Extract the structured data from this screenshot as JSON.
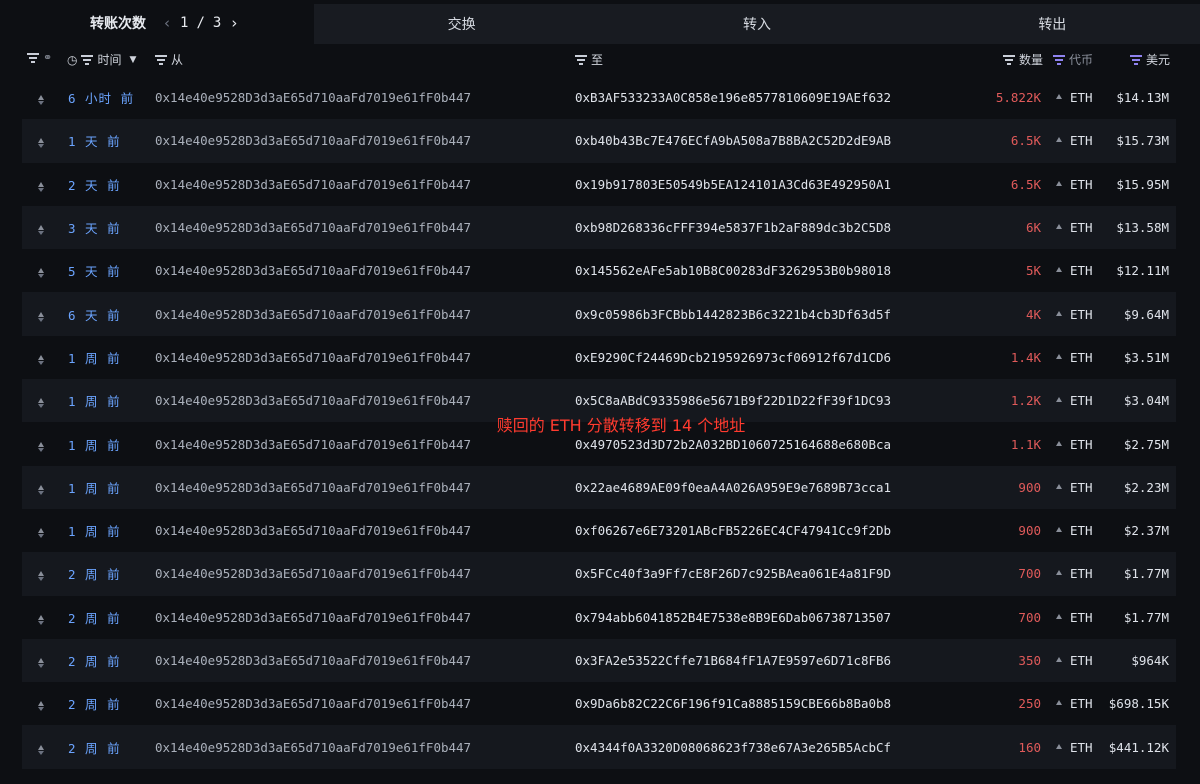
{
  "tabs": {
    "transfers_label": "转账次数",
    "page_current": "1",
    "page_sep": "/",
    "page_total": "3",
    "swap": "交换",
    "inflow": "转入",
    "outflow": "转出"
  },
  "columns": {
    "time": "时间",
    "from": "从",
    "to": "至",
    "amount": "数量",
    "token": "代币",
    "usd": "美元"
  },
  "accent_colors": {
    "time_link": "#6ba4ff",
    "amount_out": "#e05a5a",
    "filter_purple": "#8f83f0",
    "overlay_text": "#ff3b2f"
  },
  "rows": [
    {
      "time": "6 小时 前",
      "from": "0x14e40e9528D3d3aE65d710aaFd7019e61fF0b447",
      "to": "0xB3AF533233A0C858e196e8577810609E19AEf632",
      "amount": "5.822K",
      "token": "ETH",
      "usd": "$14.13M"
    },
    {
      "time": "1 天 前",
      "from": "0x14e40e9528D3d3aE65d710aaFd7019e61fF0b447",
      "to": "0xb40b43Bc7E476ECfA9bA508a7B8BA2C52D2dE9AB",
      "amount": "6.5K",
      "token": "ETH",
      "usd": "$15.73M"
    },
    {
      "time": "2 天 前",
      "from": "0x14e40e9528D3d3aE65d710aaFd7019e61fF0b447",
      "to": "0x19b917803E50549b5EA124101A3Cd63E492950A1",
      "amount": "6.5K",
      "token": "ETH",
      "usd": "$15.95M"
    },
    {
      "time": "3 天 前",
      "from": "0x14e40e9528D3d3aE65d710aaFd7019e61fF0b447",
      "to": "0xb98D268336cFFF394e5837F1b2aF889dc3b2C5D8",
      "amount": "6K",
      "token": "ETH",
      "usd": "$13.58M"
    },
    {
      "time": "5 天 前",
      "from": "0x14e40e9528D3d3aE65d710aaFd7019e61fF0b447",
      "to": "0x145562eAFe5ab10B8C00283dF3262953B0b98018",
      "amount": "5K",
      "token": "ETH",
      "usd": "$12.11M"
    },
    {
      "time": "6 天 前",
      "from": "0x14e40e9528D3d3aE65d710aaFd7019e61fF0b447",
      "to": "0x9c05986b3FCBbb1442823B6c3221b4cb3Df63d5f",
      "amount": "4K",
      "token": "ETH",
      "usd": "$9.64M"
    },
    {
      "time": "1 周 前",
      "from": "0x14e40e9528D3d3aE65d710aaFd7019e61fF0b447",
      "to": "0xE9290Cf24469Dcb2195926973cf06912f67d1CD6",
      "amount": "1.4K",
      "token": "ETH",
      "usd": "$3.51M"
    },
    {
      "time": "1 周 前",
      "from": "0x14e40e9528D3d3aE65d710aaFd7019e61fF0b447",
      "to": "0x5C8aABdC9335986e5671B9f22D1D22fF39f1DC93",
      "amount": "1.2K",
      "token": "ETH",
      "usd": "$3.04M"
    },
    {
      "time": "1 周 前",
      "from": "0x14e40e9528D3d3aE65d710aaFd7019e61fF0b447",
      "to": "0x4970523d3D72b2A032BD1060725164688e680Bca",
      "amount": "1.1K",
      "token": "ETH",
      "usd": "$2.75M"
    },
    {
      "time": "1 周 前",
      "from": "0x14e40e9528D3d3aE65d710aaFd7019e61fF0b447",
      "to": "0x22ae4689AE09f0eaA4A026A959E9e7689B73cca1",
      "amount": "900",
      "token": "ETH",
      "usd": "$2.23M"
    },
    {
      "time": "1 周 前",
      "from": "0x14e40e9528D3d3aE65d710aaFd7019e61fF0b447",
      "to": "0xf06267e6E73201ABcFB5226EC4CF47941Cc9f2Db",
      "amount": "900",
      "token": "ETH",
      "usd": "$2.37M"
    },
    {
      "time": "2 周 前",
      "from": "0x14e40e9528D3d3aE65d710aaFd7019e61fF0b447",
      "to": "0x5FCc40f3a9Ff7cE8F26D7c925BAea061E4a81F9D",
      "amount": "700",
      "token": "ETH",
      "usd": "$1.77M"
    },
    {
      "time": "2 周 前",
      "from": "0x14e40e9528D3d3aE65d710aaFd7019e61fF0b447",
      "to": "0x794abb6041852B4E7538e8B9E6Dab06738713507",
      "amount": "700",
      "token": "ETH",
      "usd": "$1.77M"
    },
    {
      "time": "2 周 前",
      "from": "0x14e40e9528D3d3aE65d710aaFd7019e61fF0b447",
      "to": "0x3FA2e53522Cffe71B684fF1A7E9597e6D71c8FB6",
      "amount": "350",
      "token": "ETH",
      "usd": "$964K"
    },
    {
      "time": "2 周 前",
      "from": "0x14e40e9528D3d3aE65d710aaFd7019e61fF0b447",
      "to": "0x9Da6b82C22C6F196f91Ca8885159CBE66b8Ba0b8",
      "amount": "250",
      "token": "ETH",
      "usd": "$698.15K"
    },
    {
      "time": "2 周 前",
      "from": "0x14e40e9528D3d3aE65d710aaFd7019e61fF0b447",
      "to": "0x4344f0A3320D08068623f738e67A3e265B5AcbCf",
      "amount": "160",
      "token": "ETH",
      "usd": "$441.12K"
    }
  ],
  "overlay_annotation": "赎回的 ETH 分散转移到 14 个地址"
}
